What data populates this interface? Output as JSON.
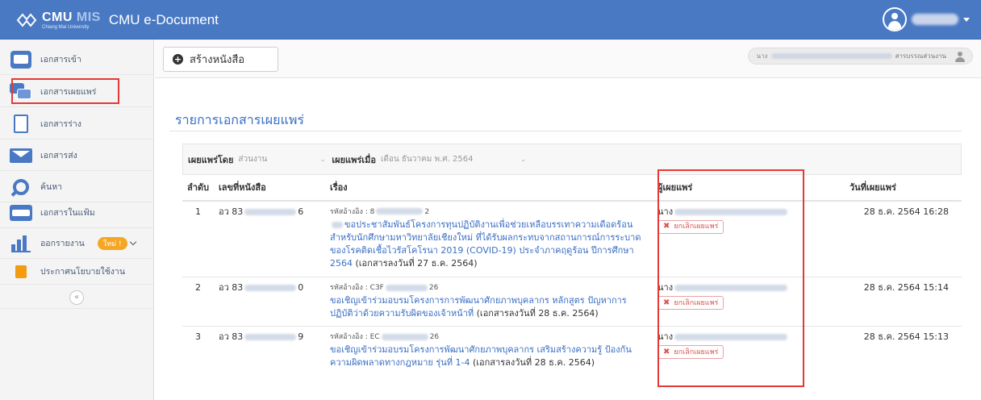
{
  "app": {
    "logo_word": "CMU",
    "logo_mis": "MIS",
    "logo_sub": "Chiang Mai University",
    "title": "CMU e-Document"
  },
  "sidebar": {
    "items": [
      {
        "label": "เอกสารเข้า",
        "icon": "inbox-envelope-icon"
      },
      {
        "label": "เอกสารเผยแพร่",
        "icon": "publish-chat-icon"
      },
      {
        "label": "เอกสารร่าง",
        "icon": "draft-document-icon"
      },
      {
        "label": "เอกสารส่ง",
        "icon": "send-envelope-icon"
      },
      {
        "label": "ค้นหา",
        "icon": "search-icon"
      },
      {
        "label": "เอกสารในแฟ้ม",
        "icon": "folder-icon"
      },
      {
        "label": "ออกรายงาน",
        "icon": "report-chart-icon",
        "badge": "ใหม่ !"
      },
      {
        "label": "ประกาศนโยบายใช้งาน",
        "icon": "book-icon"
      }
    ],
    "collapse_symbol": "«",
    "active_index": 1
  },
  "header": {
    "create_label": "สร้างหนังสือ",
    "user_prefix": "นาง",
    "user_role": "สารบรรณส่วนงาน"
  },
  "page": {
    "title": "รายการเอกสารเผยแพร่"
  },
  "filters": {
    "by_label": "เผยแพร่โดย",
    "by_value": "ส่วนงาน",
    "when_label": "เผยแพร่เมื่อ",
    "when_value": "เดือน ธันวาคม พ.ศ. 2564"
  },
  "table": {
    "headers": [
      "ลำดับ",
      "เลขที่หนังสือ",
      "เรื่อง",
      "ผู้เผยแพร่",
      "วันที่เผยแพร่"
    ],
    "cancel_label": "ยกเลิกเผยแพร่",
    "rows": [
      {
        "no": "1",
        "doc_prefix": "อว 83",
        "doc_suffix": "6",
        "ref_prefix": "รหัสอ้างอิง : 8",
        "ref_suffix": "2",
        "subject": "ขอประชาสัมพันธ์โครงการทุนปฏิบัติงานเพื่อช่วยเหลือบรรเทาความเดือดร้อน สำหรับนักศึกษามหาวิทยาลัยเชียงใหม่ ที่ได้รับผลกระทบจากสถานการณ์การระบาดของโรคติดเชื้อไวรัสโคโรนา 2019 (COVID-19) ประจำภาคฤดูร้อน ปีการศึกษา 2564",
        "date_note": "(เอกสารลงวันที่ 27 ธ.ค. 2564)",
        "publisher_prefix": "นาง",
        "published": "28 ธ.ค. 2564 16:28"
      },
      {
        "no": "2",
        "doc_prefix": "อว 83",
        "doc_suffix": "0",
        "ref_prefix": "รหัสอ้างอิง : C3F",
        "ref_suffix": "26",
        "subject": "ขอเชิญเข้าร่วมอบรมโครงการการพัฒนาศักยภาพบุคลากร หลักสูตร ปัญหาการปฏิบัติว่าด้วยความรับผิดของเจ้าหน้าที่",
        "date_note": "(เอกสารลงวันที่ 28 ธ.ค. 2564)",
        "publisher_prefix": "นาง",
        "published": "28 ธ.ค. 2564 15:14"
      },
      {
        "no": "3",
        "doc_prefix": "อว 83",
        "doc_suffix": "9",
        "ref_prefix": "รหัสอ้างอิง : EC",
        "ref_suffix": "26",
        "subject": "ขอเชิญเข้าร่วมอบรมโครงการพัฒนาศักยภาพบุคลากร เสริมสร้างความรู้ ป้องกันความผิดพลาดทางกฎหมาย รุ่นที่ 1-4",
        "date_note": "(เอกสารลงวันที่ 28 ธ.ค. 2564)",
        "publisher_prefix": "นาง",
        "published": "28 ธ.ค. 2564 15:13"
      }
    ]
  },
  "colors": {
    "topbar": "#4a79c4",
    "link": "#3a6fc4",
    "highlight": "#e53935",
    "cancel": "#d9534f",
    "badge": "#f5a623"
  }
}
